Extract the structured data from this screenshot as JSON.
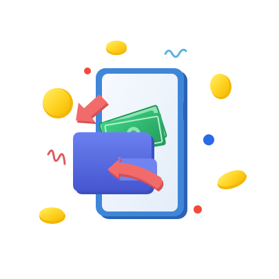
{
  "illustration": {
    "subject": "mobile-wallet-transfer",
    "icons": [
      "smartphone-icon",
      "wallet-icon",
      "banknotes-icon",
      "arrow-in-icon",
      "arrow-out-icon",
      "coin-icon",
      "squiggle-icon",
      "dot-icon"
    ]
  },
  "colors": {
    "background": "#ffffff",
    "phone_frame": "#3f86d8",
    "phone_frame_dark": "#2a63b3",
    "phone_screen": "#eef4fb",
    "wallet": "#5b6fe0",
    "wallet_dark": "#3d4fc0",
    "wallet_flap": "#6f84f0",
    "cash": "#2fbe72",
    "cash_dark": "#1e9a58",
    "cash_light": "#8fe3b4",
    "arrow": "#f26b6b",
    "arrow_dark": "#d74f56",
    "coin": "#ffd21f",
    "coin_dark": "#f2b705",
    "squiggle_blue": "#59b3dd",
    "squiggle_red": "#e0595b",
    "dot_red": "#f24a3a",
    "dot_blue": "#2a69e8"
  }
}
